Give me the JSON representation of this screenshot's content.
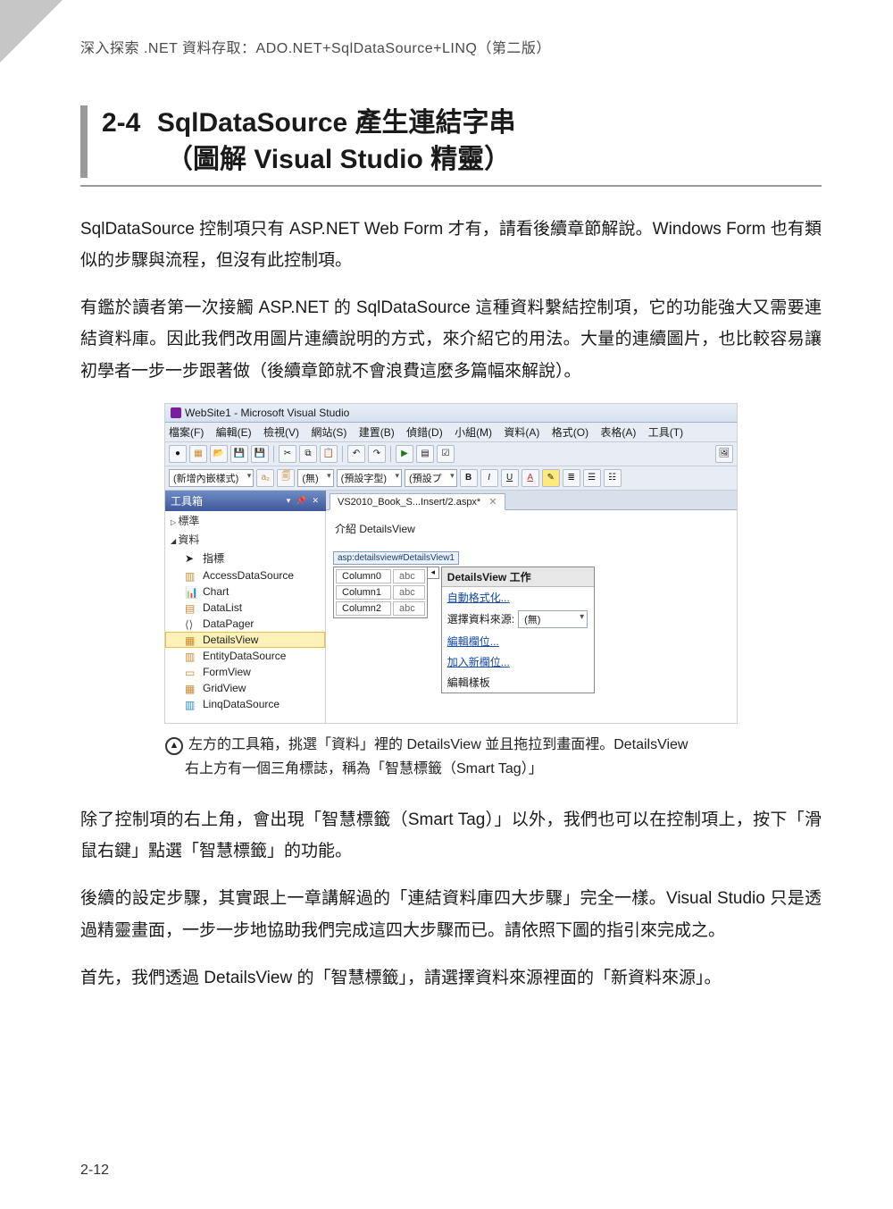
{
  "running_head": "深入探索 .NET 資料存取：ADO.NET+SqlDataSource+LINQ（第二版）",
  "section": {
    "number": "2-4",
    "title_line1": "SqlDataSource 產生連結字串",
    "title_line2": "（圖解 Visual Studio 精靈）"
  },
  "paragraphs": {
    "p1": "SqlDataSource 控制項只有 ASP.NET Web Form 才有，請看後續章節解說。Windows Form 也有類似的步驟與流程，但沒有此控制項。",
    "p2": "有鑑於讀者第一次接觸 ASP.NET 的 SqlDataSource 這種資料繫結控制項，它的功能強大又需要連結資料庫。因此我們改用圖片連續說明的方式，來介紹它的用法。大量的連續圖片，也比較容易讓初學者一步一步跟著做（後續章節就不會浪費這麼多篇幅來解說）。",
    "p3": "除了控制項的右上角，會出現「智慧標籤（Smart Tag）」以外，我們也可以在控制項上，按下「滑鼠右鍵」點選「智慧標籤」的功能。",
    "p4": "後續的設定步驟，其實跟上一章講解過的「連結資料庫四大步驟」完全一樣。Visual Studio 只是透過精靈畫面，一步一步地協助我們完成這四大步驟而已。請依照下圖的指引來完成之。",
    "p5": "首先，我們透過 DetailsView 的「智慧標籤」，請選擇資料來源裡面的「新資料來源」。"
  },
  "figure": {
    "window_title": "WebSite1 - Microsoft Visual Studio",
    "menu": [
      "檔案(F)",
      "編輯(E)",
      "檢視(V)",
      "網站(S)",
      "建置(B)",
      "偵錯(D)",
      "小組(M)",
      "資料(A)",
      "格式(O)",
      "表格(A)",
      "工具(T)"
    ],
    "format_combo1": "(新增內嵌樣式)",
    "format_combo2": "(無)",
    "format_combo3": "(預設字型)",
    "format_combo4": "(預設プ",
    "toolbox_title": "工具箱",
    "toolbox_cat_standard": "標準",
    "toolbox_cat_data": "資料",
    "toolbox_items": [
      "指標",
      "AccessDataSource",
      "Chart",
      "DataList",
      "DataPager",
      "DetailsView",
      "EntityDataSource",
      "FormView",
      "GridView",
      "LinqDataSource"
    ],
    "toolbox_selected": "DetailsView",
    "tab_label": "VS2010_Book_S...Insert/2.aspx*",
    "editor_intro": "介紹 DetailsView",
    "selector_text": "asp:detailsview#DetailsView1",
    "grid_rows": [
      {
        "c": "Column0",
        "v": "abc"
      },
      {
        "c": "Column1",
        "v": "abc"
      },
      {
        "c": "Column2",
        "v": "abc"
      }
    ],
    "smart_title": "DetailsView 工作",
    "smart_autoformat": "自動格式化...",
    "smart_choose_ds_label": "選擇資料來源:",
    "smart_choose_ds_value": "(無)",
    "smart_edit_fields": "編輯欄位...",
    "smart_add_field": "加入新欄位...",
    "smart_edit_template": "編輯樣板"
  },
  "caption": {
    "line1": "左方的工具箱，挑選「資料」裡的 DetailsView 並且拖拉到畫面裡。DetailsView",
    "line2": "右上方有一個三角標誌，稱為「智慧標籤（Smart Tag）」"
  },
  "page_number": "2-12"
}
